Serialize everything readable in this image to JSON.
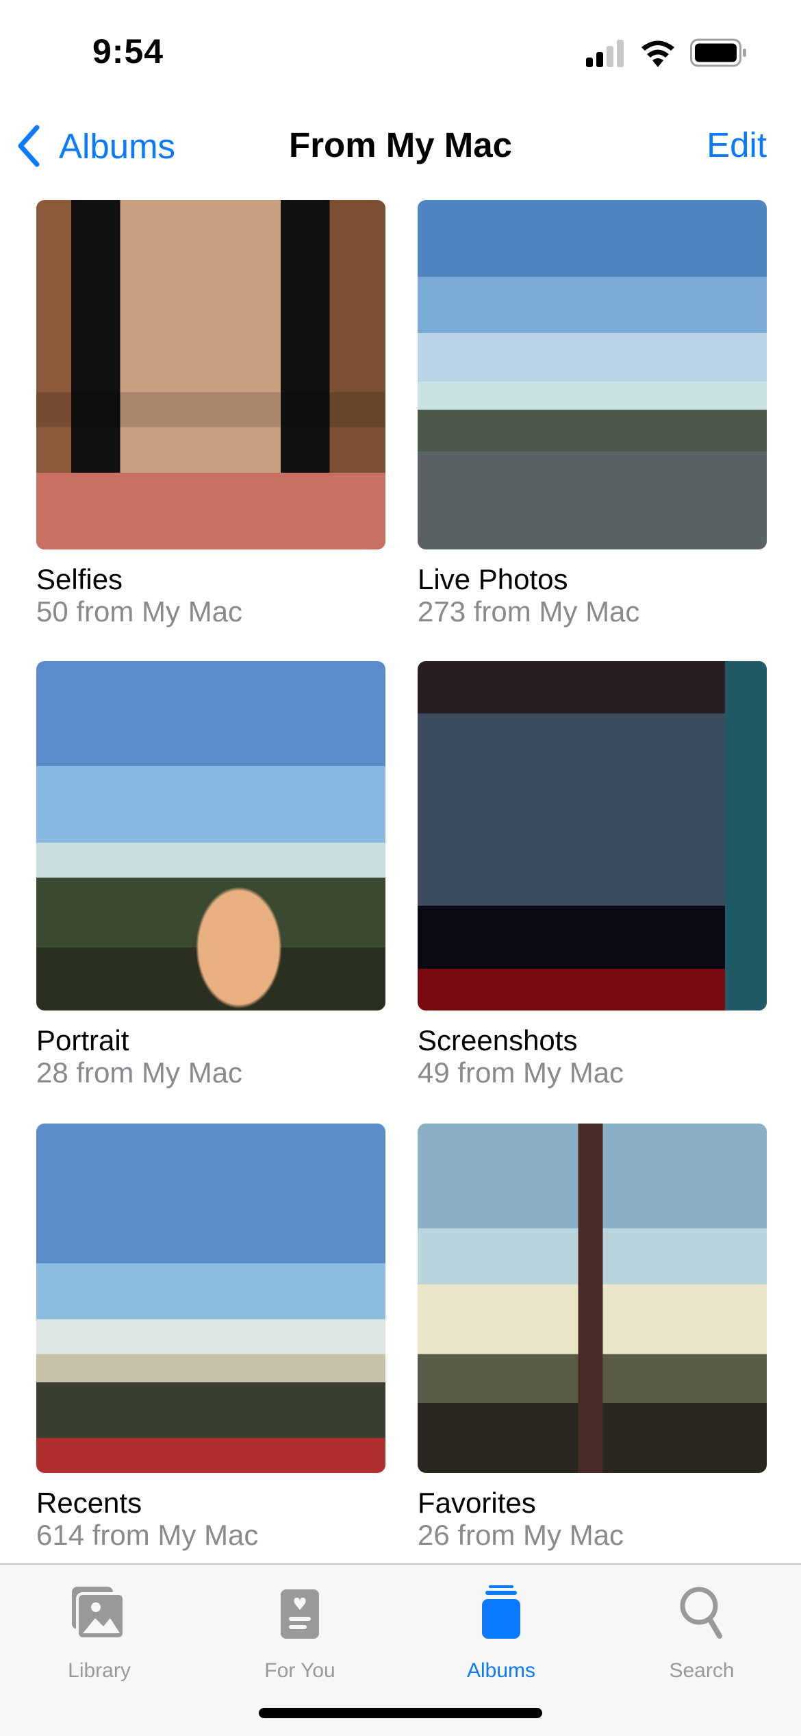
{
  "status_bar": {
    "time": "9:54",
    "signal_icon": "cellular-signal-icon",
    "wifi_icon": "wifi-icon",
    "battery_icon": "battery-icon"
  },
  "nav": {
    "back_label": "Albums",
    "title": "From My Mac",
    "edit_label": "Edit"
  },
  "albums": [
    {
      "name": "Selfies",
      "count": "50 from My Mac"
    },
    {
      "name": "Live Photos",
      "count": "273 from My Mac"
    },
    {
      "name": "Portrait",
      "count": "28 from My Mac"
    },
    {
      "name": "Screenshots",
      "count": "49 from My Mac"
    },
    {
      "name": "Recents",
      "count": "614 from My Mac"
    },
    {
      "name": "Favorites",
      "count": "26 from My Mac"
    }
  ],
  "tabbar": {
    "items": [
      {
        "label": "Library",
        "icon": "library-icon",
        "active": false
      },
      {
        "label": "For You",
        "icon": "for-you-icon",
        "active": false
      },
      {
        "label": "Albums",
        "icon": "albums-icon",
        "active": true
      },
      {
        "label": "Search",
        "icon": "search-icon",
        "active": false
      }
    ]
  },
  "colors": {
    "accent": "#0a7aff",
    "secondary_text": "#8a8a8e",
    "inactive_tab": "#999999"
  }
}
